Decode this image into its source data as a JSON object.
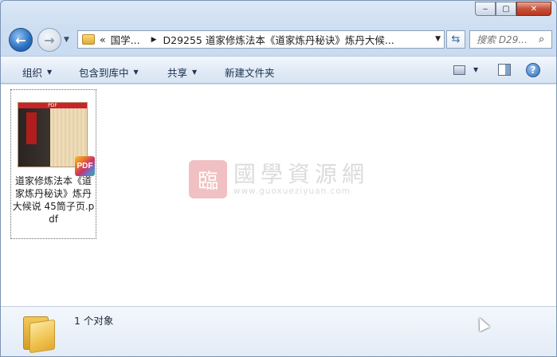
{
  "address": {
    "overflow": "«",
    "crumbs": [
      "国学...",
      "D29255 道家修炼法本《道家炼丹秘诀》炼丹大候..."
    ]
  },
  "search": {
    "placeholder": "搜索 D29..."
  },
  "toolbar": {
    "organize": "组织",
    "include_library": "包含到库中",
    "share": "共享",
    "new_folder": "新建文件夹"
  },
  "files": [
    {
      "name": "道家修炼法本《道家炼丹秘诀》炼丹大候说 45筒子页.pdf",
      "thumb_header": "PDF",
      "badge": "PDF"
    }
  ],
  "watermark": {
    "seal": "臨",
    "title": "國學資源網",
    "url": "www.guoxueziyuan.com"
  },
  "status": {
    "count": "1 个对象"
  },
  "window": {
    "minimize": "‒",
    "maximize": "▢",
    "close": "✕"
  }
}
